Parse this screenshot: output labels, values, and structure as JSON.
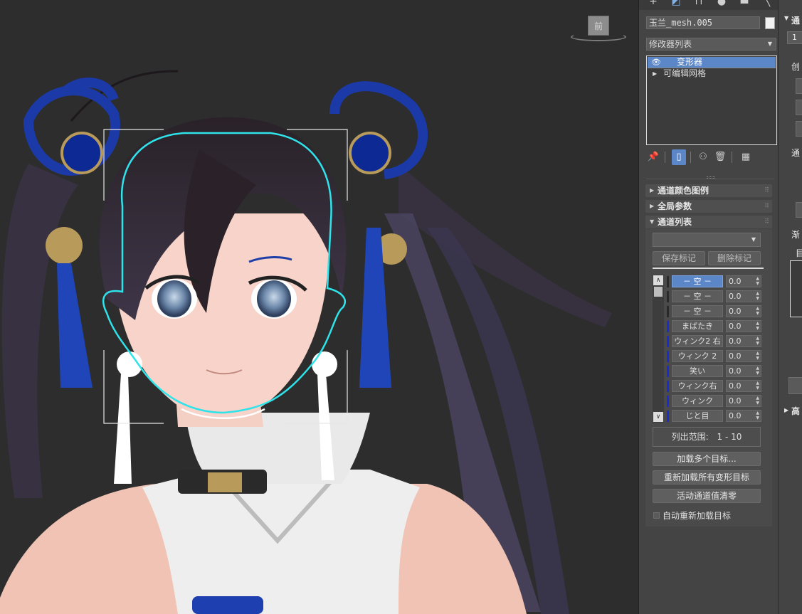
{
  "viewport": {
    "viewcube_label": "前"
  },
  "panel": {
    "tab_icons": [
      "plus-icon",
      "modify-icon",
      "hierarchy-icon",
      "motion-icon",
      "display-icon",
      "utilities-icon"
    ],
    "object_name": "玉兰_mesh.005",
    "object_color": "#f2f2f2",
    "modifier_list_label": "修改器列表",
    "stack": [
      {
        "label": "变形器",
        "selected": true
      },
      {
        "label": "可编辑网格",
        "selected": false
      }
    ],
    "rollouts": {
      "channel_color_legend": "通道颜色图例",
      "global_params": "全局参数",
      "channel_list": "通道列表"
    },
    "save_marker": "保存标记",
    "delete_marker": "删除标记",
    "channels": [
      {
        "name": "－ 空 －",
        "value": "0.0",
        "selected": true,
        "color": "dark"
      },
      {
        "name": "－ 空 －",
        "value": "0.0",
        "selected": false,
        "color": "dark"
      },
      {
        "name": "－ 空 －",
        "value": "0.0",
        "selected": false,
        "color": "dark"
      },
      {
        "name": "まばたき",
        "value": "0.0",
        "selected": false,
        "color": "blue"
      },
      {
        "name": "ウィンク2 右",
        "value": "0.0",
        "selected": false,
        "color": "blue"
      },
      {
        "name": "ウィンク 2",
        "value": "0.0",
        "selected": false,
        "color": "blue"
      },
      {
        "name": "笑い",
        "value": "0.0",
        "selected": false,
        "color": "blue"
      },
      {
        "name": "ウィンク右",
        "value": "0.0",
        "selected": false,
        "color": "blue"
      },
      {
        "name": "ウィンク",
        "value": "0.0",
        "selected": false,
        "color": "blue"
      },
      {
        "name": "じと目",
        "value": "0.0",
        "selected": false,
        "color": "blue"
      }
    ],
    "list_range_label": "列出范围:",
    "list_range_value": "1 - 10",
    "load_multiple_targets": "加载多个目标...",
    "reload_all_targets": "重新加载所有变形目标",
    "zero_active_channels": "活动通道值清零",
    "auto_reload_targets": "自动重新加载目标"
  },
  "panel2": {
    "header": "通",
    "field_value": "1",
    "create_label": "创",
    "channel_label": "通",
    "new_label": "渐",
    "target_label": "目",
    "advanced_label": "高"
  },
  "colors": {
    "accent": "#5b86c8",
    "channel_blue": "#1b2cd4",
    "selection_outline": "#2fe3ea"
  }
}
